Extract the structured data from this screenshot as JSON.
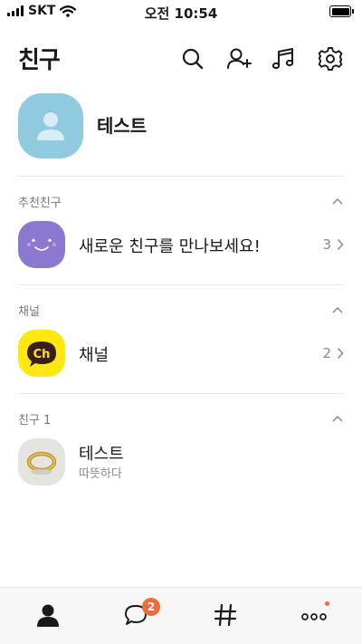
{
  "status_bar": {
    "carrier": "SKT",
    "time": "오전 10:54"
  },
  "header": {
    "title": "친구"
  },
  "my_profile": {
    "name": "테스트"
  },
  "sections": {
    "recommended": {
      "title": "추천친구",
      "row_label": "새로운 친구를 만나보세요!",
      "count": "3"
    },
    "channel": {
      "title": "채널",
      "row_label": "채널",
      "count": "2"
    },
    "friends": {
      "title": "친구 1",
      "items": [
        {
          "name": "테스트",
          "status": "따뜻하다"
        }
      ]
    }
  },
  "tabbar": {
    "chats_badge": "2"
  },
  "colors": {
    "profile_bg": "#8fcadf",
    "recommend_bg": "#8b78cf",
    "channel_bg": "#ffe812",
    "badge": "#f26b3a"
  },
  "icons": [
    "search-icon",
    "add-friend-icon",
    "music-icon",
    "gear-icon",
    "person-icon",
    "chat-bubble-icon",
    "hashtag-icon",
    "more-icon"
  ]
}
